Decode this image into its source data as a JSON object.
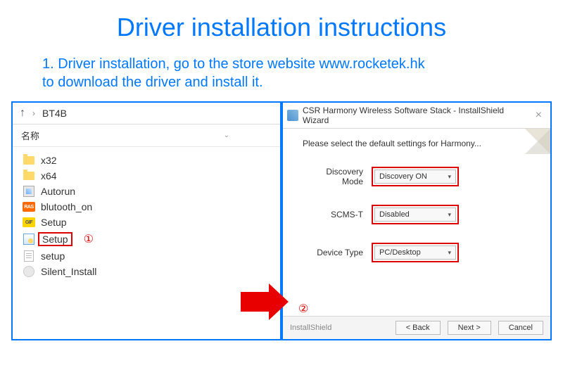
{
  "title": "Driver installation instructions",
  "instruction": "1. Driver installation, go to the store website www.rocketek.hk\n     to download the driver and install it.",
  "explorer": {
    "up_label": "↑",
    "crumb_sep": "›",
    "folder": "BT4B",
    "name_header": "名称",
    "items": [
      {
        "type": "folder",
        "label": "x32"
      },
      {
        "type": "folder",
        "label": "x64"
      },
      {
        "type": "exe",
        "label": "Autorun"
      },
      {
        "type": "ras",
        "label": "blutooth_on"
      },
      {
        "type": "gif",
        "label": "Setup"
      },
      {
        "type": "msi",
        "label": "Setup",
        "highlight": true
      },
      {
        "type": "ini",
        "label": "setup"
      },
      {
        "type": "cog",
        "label": "Silent_Install"
      }
    ],
    "badge_ras": "RAS",
    "badge_gif": "GIF",
    "circle1": "①"
  },
  "installer": {
    "title": "CSR Harmony Wireless Software Stack - InstallShield Wizard",
    "prompt": "Please select the default settings for Harmony...",
    "fields": [
      {
        "label": "Discovery Mode",
        "value": "Discovery ON"
      },
      {
        "label": "SCMS-T",
        "value": "Disabled"
      },
      {
        "label": "Device Type",
        "value": "PC/Desktop"
      }
    ],
    "circle2": "②",
    "footer_brand": "InstallShield",
    "buttons": {
      "back": "< Back",
      "next": "Next >",
      "cancel": "Cancel"
    }
  }
}
